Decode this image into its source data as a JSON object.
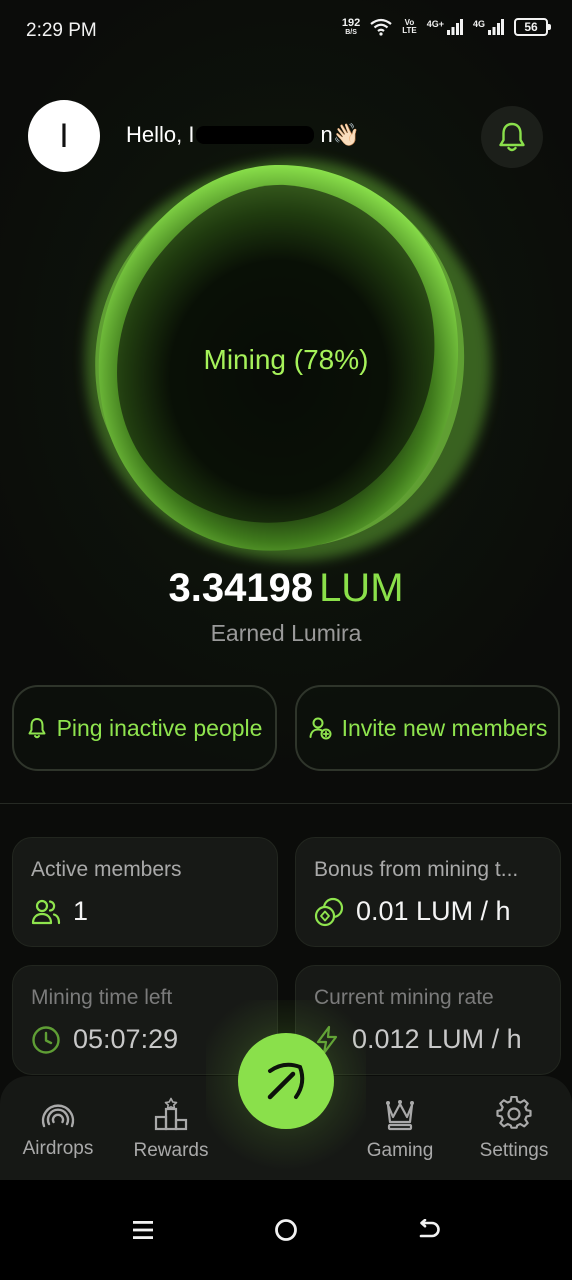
{
  "status_bar": {
    "time": "2:29 PM",
    "net_speed_value": "192",
    "net_speed_unit": "B/S",
    "volte_top": "Vo",
    "volte_bottom": "LTE",
    "sim1_label": "4G+",
    "sim2_label": "4G",
    "battery": "56",
    "icons": [
      "wifi-icon",
      "signal-icon",
      "battery-icon"
    ]
  },
  "header": {
    "avatar_initial": "I",
    "greeting_prefix": "Hello, I",
    "greeting_suffix": "n",
    "wave_emoji": "👋🏻",
    "bell_icon": "bell-icon"
  },
  "mining": {
    "label": "Mining (78%)",
    "progress_percent": 78
  },
  "earnings": {
    "amount": "3.34198",
    "unit": "LUM",
    "caption": "Earned Lumira"
  },
  "actions": {
    "ping_label": "Ping inactive people",
    "invite_label": "Invite new members"
  },
  "stats": [
    {
      "title": "Active members",
      "value": "1",
      "icon": "users-icon"
    },
    {
      "title": "Bonus from mining t...",
      "value": "0.01 LUM / h",
      "icon": "coins-icon"
    },
    {
      "title": "Mining time left",
      "value": "05:07:29",
      "icon": "clock-icon"
    },
    {
      "title": "Current mining rate",
      "value": "0.012 LUM / h",
      "icon": "lightning-icon"
    }
  ],
  "bottom_nav": [
    {
      "label": "Airdrops",
      "icon": "airdrop-icon"
    },
    {
      "label": "Rewards",
      "icon": "podium-icon"
    },
    {
      "label": "",
      "icon": "pickaxe-icon"
    },
    {
      "label": "Gaming",
      "icon": "chess-queen-icon"
    },
    {
      "label": "Settings",
      "icon": "gear-icon"
    }
  ],
  "colors": {
    "accent": "#8ae04b",
    "background": "#0b0c0a",
    "card": "#171916"
  }
}
